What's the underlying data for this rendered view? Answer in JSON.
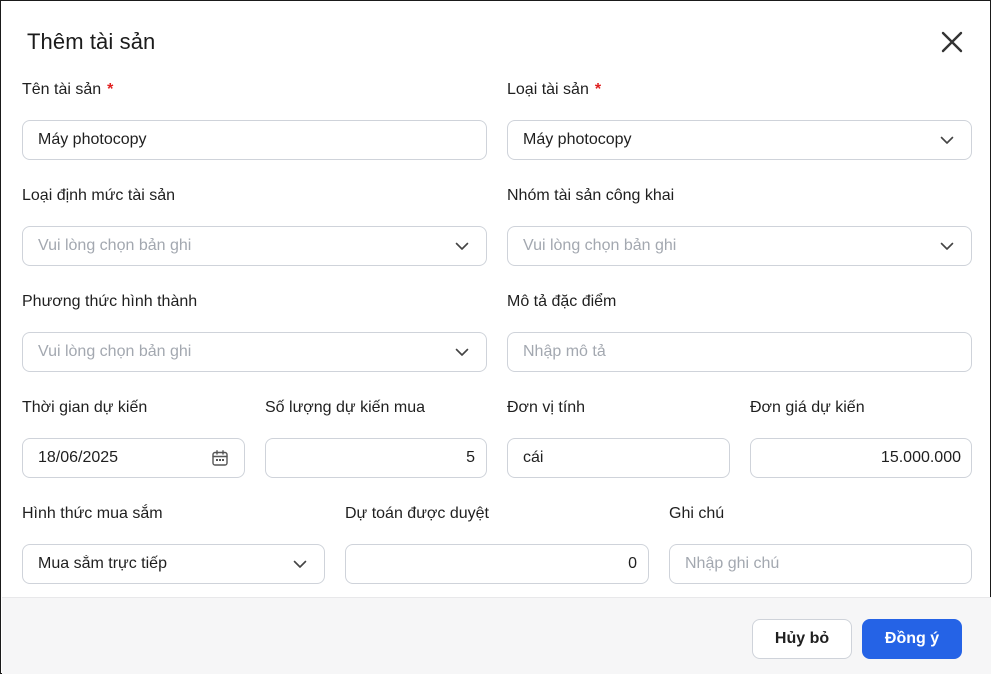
{
  "dialog": {
    "title": "Thêm tài sản"
  },
  "fields": {
    "ten_tai_san": {
      "label": "Tên tài sản",
      "required": "*",
      "value": "Máy photocopy"
    },
    "loai_tai_san": {
      "label": "Loại tài sản",
      "required": "*",
      "value": "Máy photocopy"
    },
    "loai_dinh_muc": {
      "label": "Loại định mức tài sản",
      "placeholder": "Vui lòng chọn bản ghi"
    },
    "nhom_cong_khai": {
      "label": "Nhóm tài sản công khai",
      "placeholder": "Vui lòng chọn bản ghi"
    },
    "phuong_thuc": {
      "label": "Phương thức hình thành",
      "placeholder": "Vui lòng chọn bản ghi"
    },
    "mo_ta": {
      "label": "Mô tả đặc điểm",
      "placeholder": "Nhập mô tả"
    },
    "thoi_gian": {
      "label": "Thời gian dự kiến",
      "value": "18/06/2025"
    },
    "so_luong": {
      "label": "Số lượng dự kiến mua",
      "value": "5"
    },
    "don_vi": {
      "label": "Đơn vị tính",
      "value": "cái"
    },
    "don_gia": {
      "label": "Đơn giá dự kiến",
      "value": "15.000.000"
    },
    "hinh_thuc": {
      "label": "Hình thức mua sắm",
      "value": "Mua sắm trực tiếp"
    },
    "du_toan": {
      "label": "Dự toán được duyệt",
      "value": "0"
    },
    "ghi_chu": {
      "label": "Ghi chú",
      "placeholder": "Nhập ghi chú"
    }
  },
  "footer": {
    "cancel_label": "Hủy bỏ",
    "ok_label": "Đồng ý"
  },
  "icons": {
    "close": "close-icon",
    "chevron": "chevron-down-icon",
    "calendar": "calendar-icon"
  },
  "colors": {
    "primary": "#2563e6",
    "required": "#e02020",
    "border": "#cfd3da",
    "placeholder": "#a3a8b0"
  }
}
